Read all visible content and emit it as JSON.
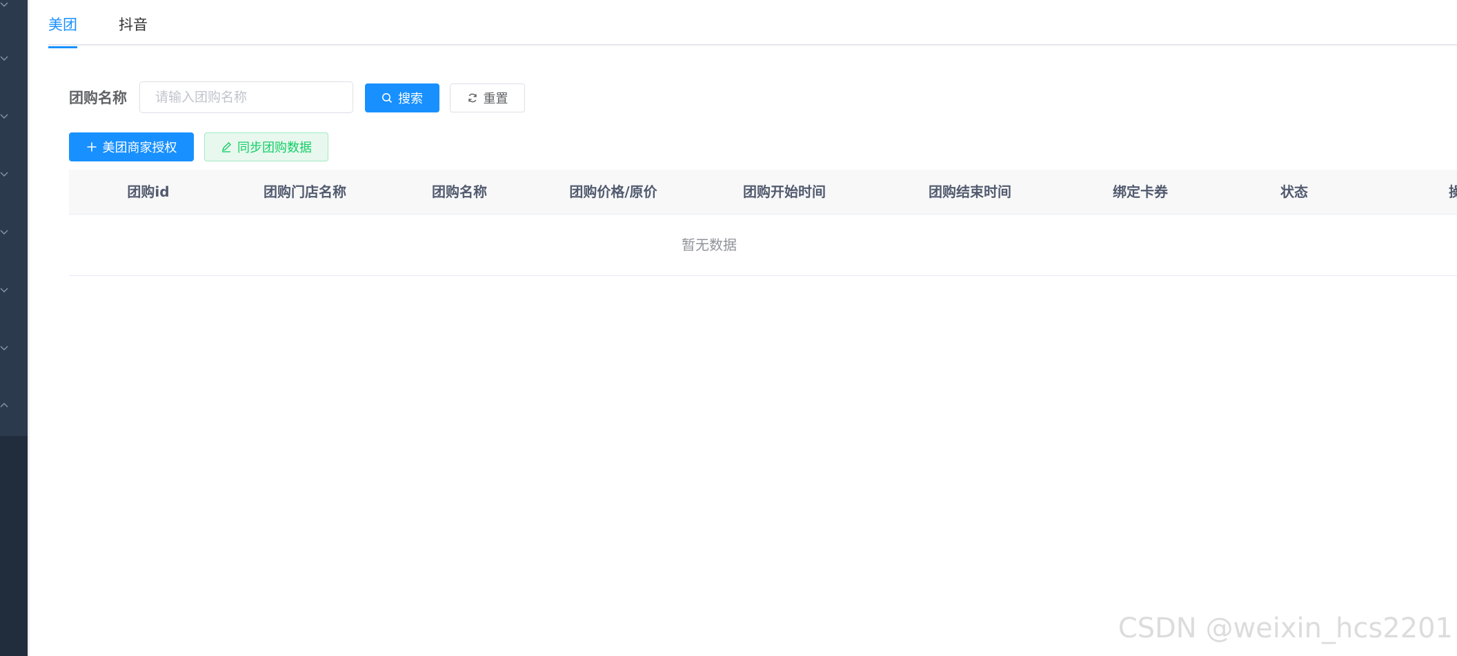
{
  "tabs": [
    {
      "label": "美团",
      "active": true
    },
    {
      "label": "抖音",
      "active": false
    }
  ],
  "search": {
    "label": "团购名称",
    "placeholder": "请输入团购名称",
    "search_button": "搜索",
    "reset_button": "重置"
  },
  "actions": {
    "auth_button": "美团商家授权",
    "sync_button": "同步团购数据"
  },
  "table": {
    "columns": [
      "团购id",
      "团购门店名称",
      "团购名称",
      "团购价格/原价",
      "团购开始时间",
      "团购结束时间",
      "绑定卡券",
      "状态",
      "操作"
    ],
    "empty_text": "暂无数据"
  },
  "watermark": "CSDN @weixin_hcs2201",
  "colors": {
    "primary": "#1890ff",
    "success": "#13ce66",
    "sidebar": "#2b3a4d",
    "sidebar_dark": "#212d3c"
  },
  "icons": {
    "sidebar_chevrons": [
      "chevron-down-icon",
      "chevron-down-icon",
      "chevron-down-icon",
      "chevron-down-icon",
      "chevron-down-icon",
      "chevron-down-icon",
      "chevron-down-icon",
      "chevron-up-icon"
    ],
    "search_button": "search-icon",
    "reset_button": "refresh-icon",
    "auth_button": "plus-icon",
    "sync_button": "edit-icon"
  }
}
